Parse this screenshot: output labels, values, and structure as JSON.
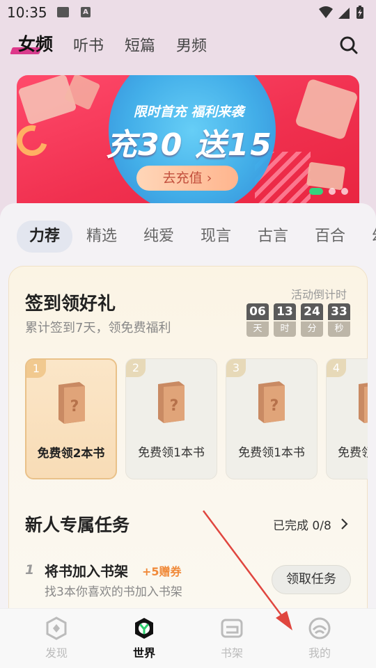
{
  "status": {
    "time": "10:35"
  },
  "top_nav": {
    "tabs": [
      "女频",
      "听书",
      "短篇",
      "男频"
    ]
  },
  "banner": {
    "subtitle": "限时首充  福利来袭",
    "headline": "充30  送15",
    "button": "去充值  ›"
  },
  "categories": [
    "力荐",
    "精选",
    "纯爱",
    "现言",
    "古言",
    "百合",
    "幻"
  ],
  "checkin": {
    "title": "签到领好礼",
    "subtitle": "累计签到7天，领免费福利",
    "countdown_label": "活动倒计时",
    "countdown": [
      {
        "num": "06",
        "unit": "天"
      },
      {
        "num": "13",
        "unit": "时"
      },
      {
        "num": "24",
        "unit": "分"
      },
      {
        "num": "33",
        "unit": "秒"
      }
    ],
    "gifts": [
      {
        "index": "1",
        "label": "免费领2本书"
      },
      {
        "index": "2",
        "label": "免费领1本书"
      },
      {
        "index": "3",
        "label": "免费领1本书"
      },
      {
        "index": "4",
        "label": "免费领"
      }
    ]
  },
  "tasks": {
    "title": "新人专属任务",
    "progress": "已完成 0/8",
    "items": [
      {
        "index": "1",
        "name": "将书加入书架",
        "reward": "+5赠券",
        "desc": "找3本你喜欢的书加入书架",
        "button": "领取任务"
      }
    ]
  },
  "bottom_nav": {
    "items": [
      "发现",
      "世界",
      "书架",
      "我的"
    ]
  },
  "colors": {
    "accent": "#e0378a",
    "reward": "#f08a3a",
    "banner": "#f0304f"
  }
}
